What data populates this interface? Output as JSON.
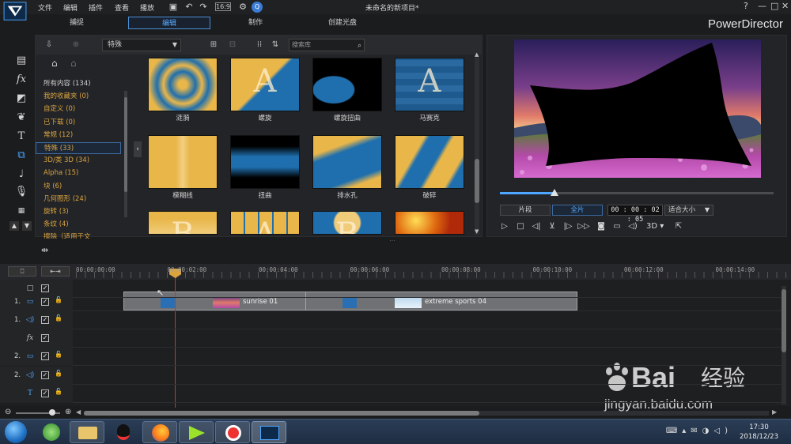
{
  "window": {
    "title": "未命名的新项目*",
    "brand": "PowerDirector",
    "menu": [
      "文件",
      "编辑",
      "插件",
      "查看",
      "播放"
    ]
  },
  "mode_tabs": [
    {
      "label": "捕捉",
      "active": false
    },
    {
      "label": "编辑",
      "active": true
    },
    {
      "label": "制作",
      "active": false
    },
    {
      "label": "创建光盘",
      "active": false
    }
  ],
  "library": {
    "category_select": "特殊",
    "search_placeholder": "搜索库",
    "categories": [
      {
        "label": "所有内容 (134)",
        "kind": "all"
      },
      {
        "label": "我的收藏夹 (0)",
        "kind": "normal"
      },
      {
        "label": "自定义 (0)",
        "kind": "normal"
      },
      {
        "label": "已下载 (0)",
        "kind": "normal"
      },
      {
        "label": "常规 (12)",
        "kind": "normal"
      },
      {
        "label": "特殊 (33)",
        "kind": "selected"
      },
      {
        "label": "3D/类 3D (34)",
        "kind": "normal"
      },
      {
        "label": "Alpha (15)",
        "kind": "normal"
      },
      {
        "label": "块 (6)",
        "kind": "normal"
      },
      {
        "label": "几何图形 (24)",
        "kind": "normal"
      },
      {
        "label": "旋转 (3)",
        "kind": "normal"
      },
      {
        "label": "条纹 (4)",
        "kind": "normal"
      },
      {
        "label": "擦除（适用于文",
        "kind": "normal"
      }
    ],
    "transitions_row1": [
      "涟漪",
      "螺旋",
      "螺旋扭曲",
      "马赛克"
    ],
    "transitions_row2": [
      "模糊线",
      "扭曲",
      "排水孔",
      "破碎"
    ]
  },
  "preview": {
    "seg_clip": "片段",
    "seg_full": "全片",
    "timecode": "00 : 00 : 02 : 05",
    "fit": "适合大小",
    "mode_3d": "3D",
    "seek_progress": 0.2
  },
  "timeline": {
    "ruler": [
      "00:00:00:00",
      "00:00:02:00",
      "00:00:04:00",
      "00:00:06:00",
      "00:00:08:00",
      "00:00:10:00",
      "00:00:12:00",
      "00:00:14:00"
    ],
    "tracks": [
      {
        "num": "",
        "icon": "□"
      },
      {
        "num": "1.",
        "icon": "▭"
      },
      {
        "num": "1.",
        "icon": "◁)"
      },
      {
        "num": "",
        "icon": "fx"
      },
      {
        "num": "2.",
        "icon": "▭"
      },
      {
        "num": "2.",
        "icon": "◁)"
      },
      {
        "num": "",
        "icon": "T"
      }
    ],
    "clip1": "sunrise 01",
    "clip2": "extreme sports 04"
  },
  "taskbar": {
    "time": "17:30",
    "date": "2018/12/23"
  },
  "watermark": {
    "line1": "Bai",
    "line2": "经验",
    "url": "jingyan.baidu.com"
  },
  "colors": {
    "accent": "#4ea6ff",
    "category": "#d9a440",
    "playhead": "#c0392b"
  }
}
